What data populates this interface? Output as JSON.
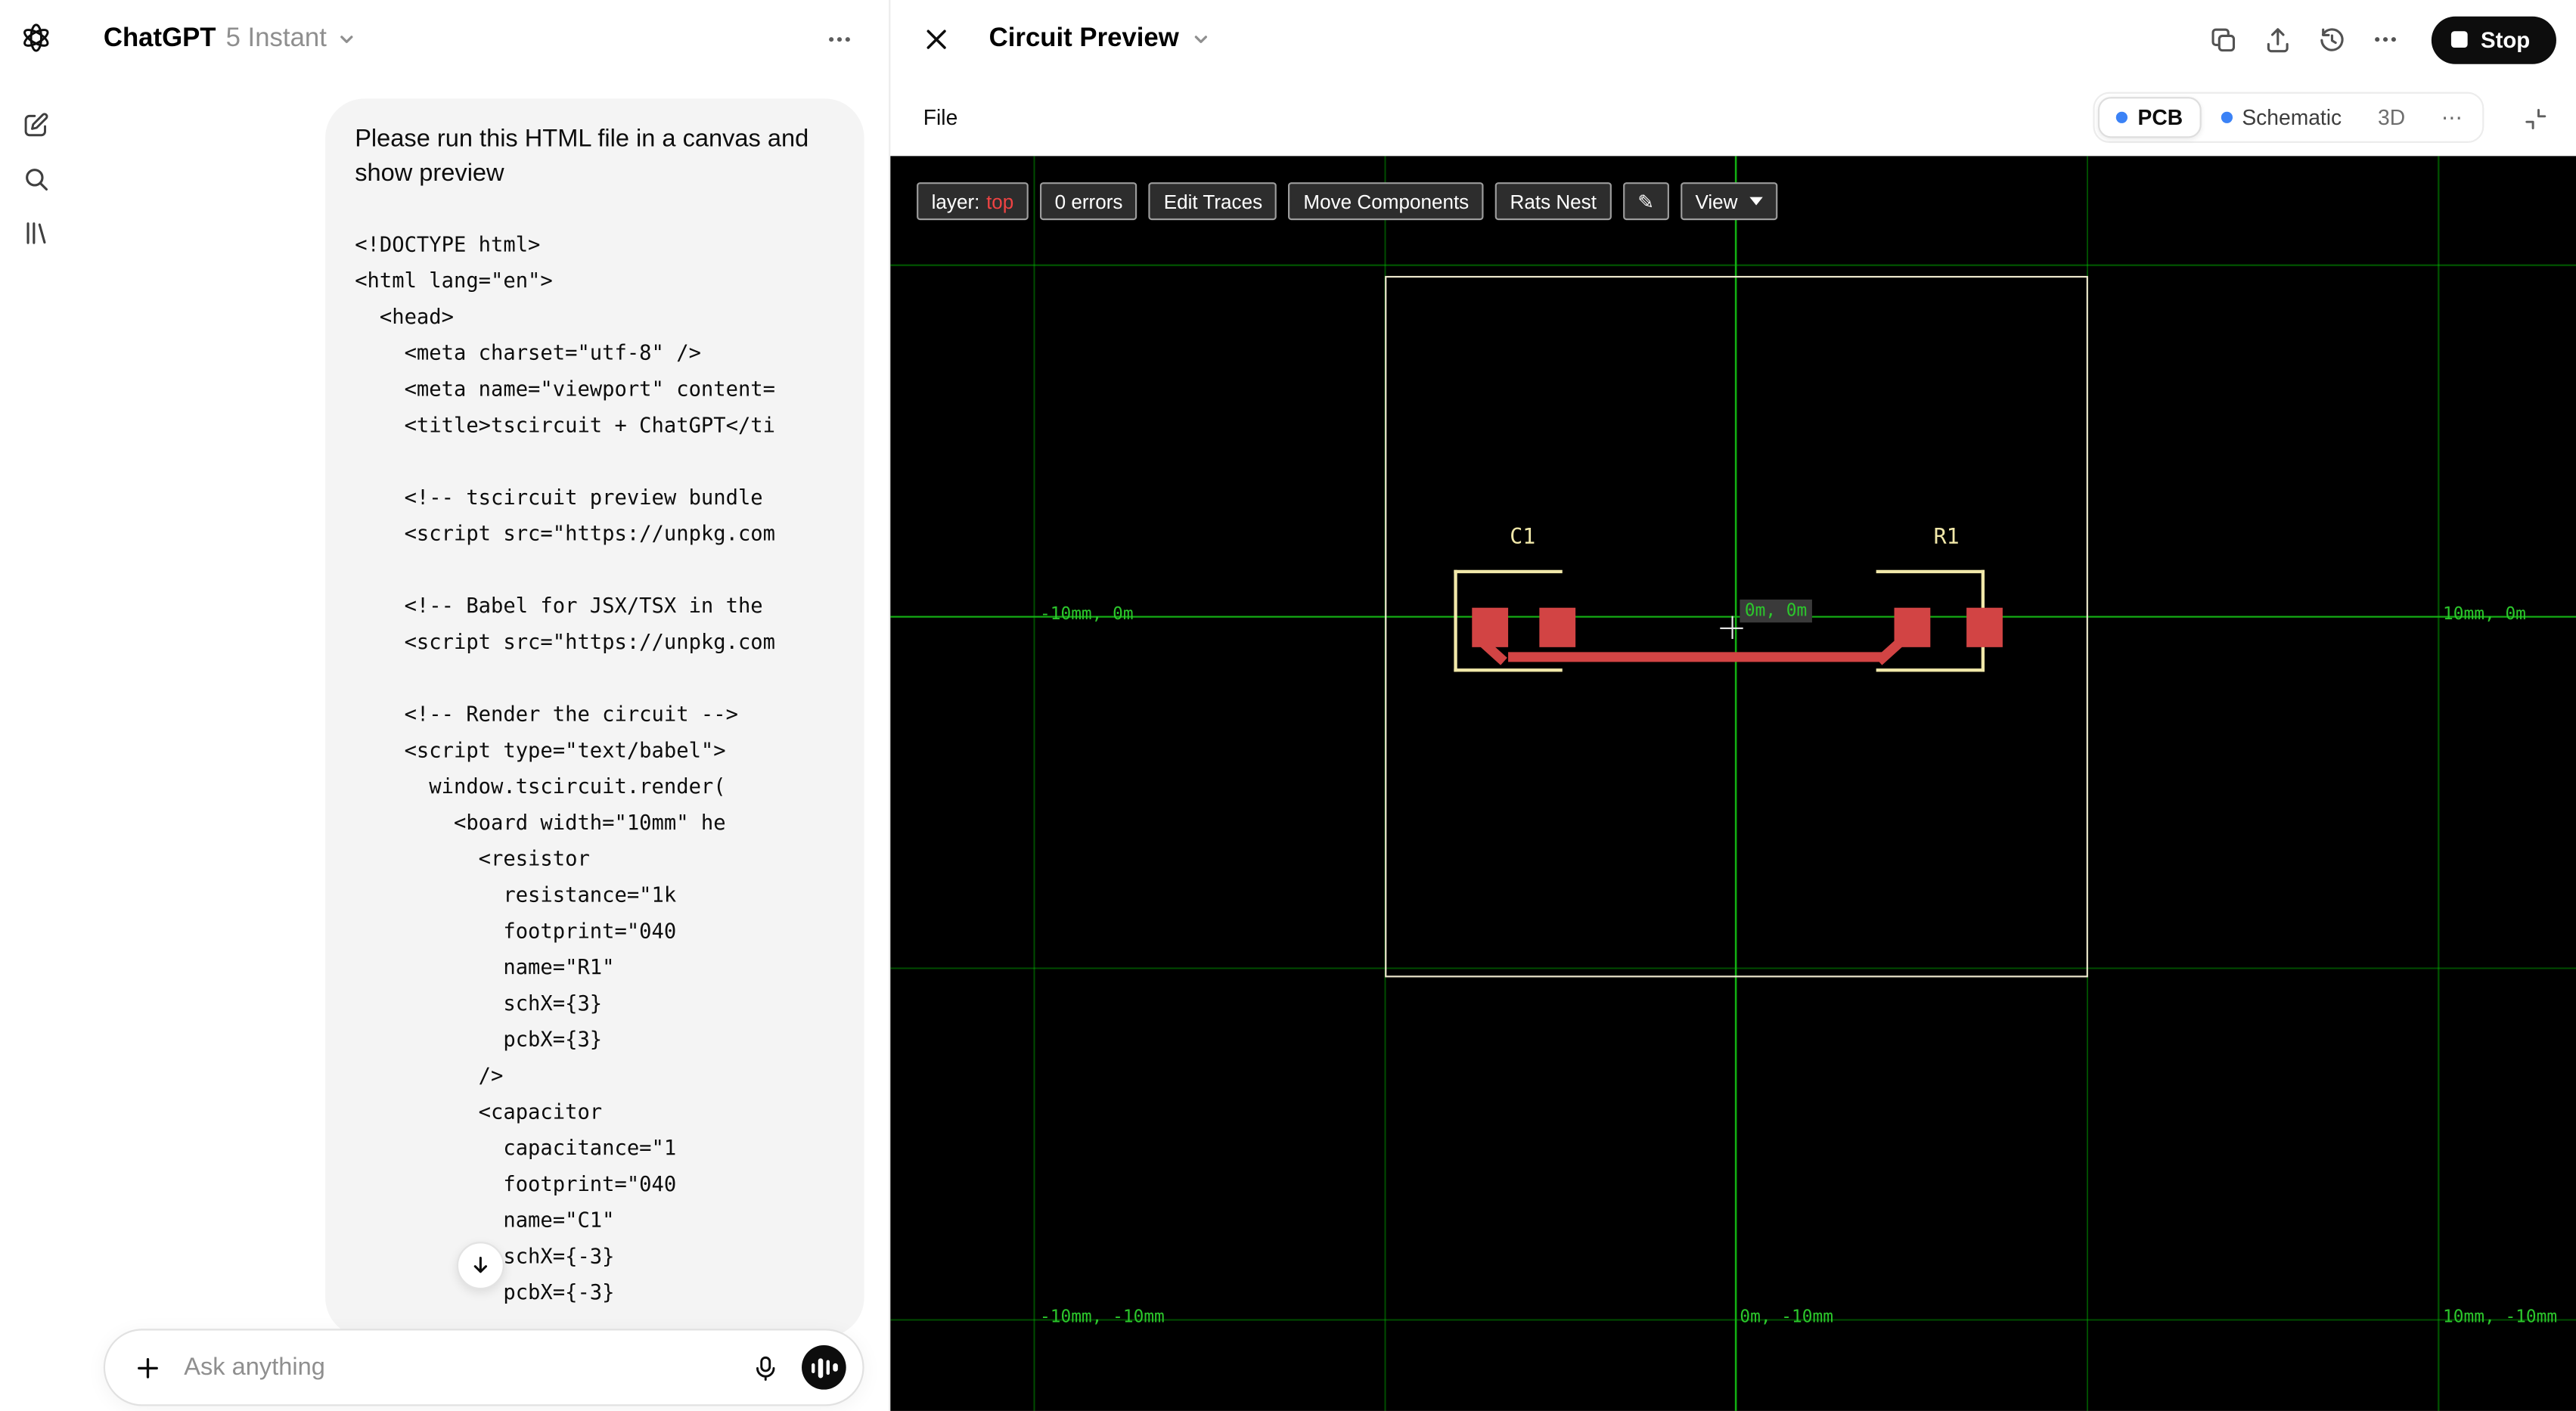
{
  "app": {
    "accent_blue": "#3b82f6"
  },
  "chat": {
    "title": "ChatGPT",
    "model": "5 Instant",
    "message": {
      "text": "Please run this HTML file in a canvas and show preview",
      "code_lines": [
        "<!DOCTYPE html>",
        "<html lang=\"en\">",
        "  <head>",
        "    <meta charset=\"utf-8\" />",
        "    <meta name=\"viewport\" content=",
        "    <title>tscircuit + ChatGPT</ti",
        "",
        "    <!-- tscircuit preview bundle",
        "    <script src=\"https://unpkg.com",
        "",
        "    <!-- Babel for JSX/TSX in the",
        "    <script src=\"https://unpkg.com",
        "",
        "    <!-- Render the circuit -->",
        "    <script type=\"text/babel\">",
        "      window.tscircuit.render(",
        "        <board width=\"10mm\" he",
        "          <resistor",
        "            resistance=\"1k",
        "            footprint=\"040",
        "            name=\"R1\"",
        "            schX={3}",
        "            pcbX={3}",
        "          />",
        "          <capacitor",
        "            capacitance=\"1",
        "            footprint=\"040",
        "            name=\"C1\"",
        "            schX={-3}",
        "            pcbX={-3}"
      ]
    },
    "composer": {
      "placeholder": "Ask anything"
    }
  },
  "canvas": {
    "title": "Circuit Preview",
    "file_menu": "File",
    "stop_label": "Stop",
    "tabs": {
      "pcb": "PCB",
      "schematic": "Schematic",
      "three_d": "3D",
      "more": "⋯"
    },
    "pcb": {
      "toolbar": {
        "layer_label": "layer:",
        "layer_value": "top",
        "errors": "0 errors",
        "edit_traces": "Edit Traces",
        "move_components": "Move Components",
        "rats_nest": "Rats Nest",
        "pencil": "✎",
        "view": "View"
      },
      "components": {
        "c1": "C1",
        "r1": "R1"
      },
      "coords": {
        "mid_left": "-10mm, 0m",
        "origin": "0m, 0m",
        "mid_right": "10mm, 0m",
        "bottom_left": "-10mm, -10mm",
        "bottom_center": "0m, -10mm",
        "bottom_right": "10mm, -10mm"
      },
      "colors": {
        "background": "#000000",
        "grid": "#00c800",
        "board_outline": "#efe9cf",
        "silkscreen": "#f1e8a9",
        "copper": "#d24444",
        "coord_text": "#2cc72c",
        "layer_top_value": "#ef4343"
      }
    }
  }
}
